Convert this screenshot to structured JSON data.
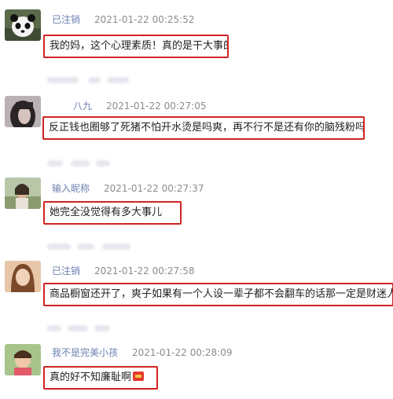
{
  "comments": [
    {
      "username": "已注销",
      "timestamp": "2021-01-22 00:25:52",
      "text": "我的妈，这个心理素质！真的是干大事的！",
      "avatar": "panda-avatar"
    },
    {
      "username": "八九",
      "timestamp": "2021-01-22 00:27:05",
      "text": "反正钱也圈够了死猪不怕开水烫是吗爽，再不行不是还有你的脑残粉吗",
      "avatar": "dark-hair-avatar"
    },
    {
      "username": "输入昵称",
      "timestamp": "2021-01-22 00:27:37",
      "text": "她完全没觉得有多大事儿",
      "avatar": "outdoor-avatar"
    },
    {
      "username": "已注销",
      "timestamp": "2021-01-22 00:27:58",
      "text": "商品橱窗还开了，爽子如果有一个人设一辈子都不会翻车的话那一定是财迷人设",
      "avatar": "portrait-avatar"
    },
    {
      "username": "我不是完美小孩",
      "timestamp": "2021-01-22 00:28:09",
      "text": "真的好不知廉耻啊",
      "avatar": "child-avatar",
      "emoji": "red-envelope-emoji"
    }
  ],
  "colors": {
    "highlight_border": "#d12424",
    "username": "#6a7fb0",
    "timestamp": "#8c8c8c"
  }
}
